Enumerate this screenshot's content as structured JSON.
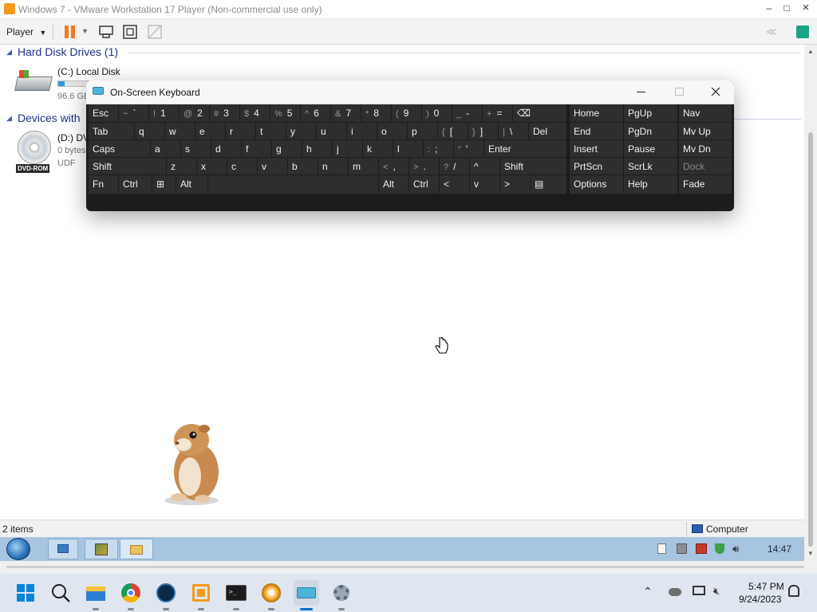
{
  "vm": {
    "title": "Windows 7 - VMware Workstation 17 Player (Non-commercial use only)",
    "menu_label": "Player",
    "window_controls": {
      "minimize": "–",
      "maximize": "□",
      "close": "×"
    },
    "collapse_label": "≪"
  },
  "explorer": {
    "group_hdd": "Hard Disk Drives (1)",
    "group_devices": "Devices with",
    "drive_c": {
      "name": "(C:) Local Disk",
      "size": "96.6 GB",
      "fill_fraction": 0.22
    },
    "drive_d": {
      "name": "(D:) DV",
      "size": "0 bytes",
      "fs": "UDF",
      "badge": "DVD-ROM"
    },
    "status_count": "2 items",
    "status_location": "Computer"
  },
  "osk": {
    "title": "On-Screen Keyboard",
    "rows": [
      [
        {
          "label": "Esc"
        },
        {
          "shift": "~",
          "label": "`"
        },
        {
          "shift": "!",
          "label": "1"
        },
        {
          "shift": "@",
          "label": "2"
        },
        {
          "shift": "#",
          "label": "3"
        },
        {
          "shift": "$",
          "label": "4"
        },
        {
          "shift": "%",
          "label": "5"
        },
        {
          "shift": "^",
          "label": "6"
        },
        {
          "shift": "&",
          "label": "7"
        },
        {
          "shift": "*",
          "label": "8"
        },
        {
          "shift": "(",
          "label": "9"
        },
        {
          "shift": ")",
          "label": "0"
        },
        {
          "shift": "_",
          "label": "-"
        },
        {
          "shift": "+",
          "label": "="
        },
        {
          "label": "⌫"
        }
      ],
      [
        {
          "label": "Tab"
        },
        {
          "label": "q"
        },
        {
          "label": "w"
        },
        {
          "label": "e"
        },
        {
          "label": "r"
        },
        {
          "label": "t"
        },
        {
          "label": "y"
        },
        {
          "label": "u"
        },
        {
          "label": "i"
        },
        {
          "label": "o"
        },
        {
          "label": "p"
        },
        {
          "shift": "{",
          "label": "["
        },
        {
          "shift": "}",
          "label": "]"
        },
        {
          "shift": "|",
          "label": "\\"
        },
        {
          "label": "Del"
        }
      ],
      [
        {
          "label": "Caps"
        },
        {
          "label": "a"
        },
        {
          "label": "s"
        },
        {
          "label": "d"
        },
        {
          "label": "f"
        },
        {
          "label": "g"
        },
        {
          "label": "h"
        },
        {
          "label": "j"
        },
        {
          "label": "k"
        },
        {
          "label": "l"
        },
        {
          "shift": ":",
          "label": ";"
        },
        {
          "shift": "\"",
          "label": "'"
        },
        {
          "label": "Enter"
        }
      ],
      [
        {
          "label": "Shift"
        },
        {
          "label": "z"
        },
        {
          "label": "x"
        },
        {
          "label": "c"
        },
        {
          "label": "v"
        },
        {
          "label": "b"
        },
        {
          "label": "n"
        },
        {
          "label": "m"
        },
        {
          "shift": "<",
          "label": ","
        },
        {
          "shift": ">",
          "label": "."
        },
        {
          "shift": "?",
          "label": "/"
        },
        {
          "label": "^"
        },
        {
          "label": "Shift"
        }
      ],
      [
        {
          "label": "Fn"
        },
        {
          "label": "Ctrl"
        },
        {
          "label": "⊞"
        },
        {
          "label": "Alt"
        },
        {
          "label": ""
        },
        {
          "label": "Alt"
        },
        {
          "label": "Ctrl"
        },
        {
          "label": "<"
        },
        {
          "label": "v"
        },
        {
          "label": ">"
        },
        {
          "label": "▤"
        }
      ]
    ],
    "nav": [
      [
        "Home",
        "PgUp",
        "Nav"
      ],
      [
        "End",
        "PgDn",
        "Mv Up"
      ],
      [
        "Insert",
        "Pause",
        "Mv Dn"
      ],
      [
        "PrtScn",
        "ScrLk",
        "Dock"
      ],
      [
        "Options",
        "Help",
        "Fade"
      ]
    ]
  },
  "guest_taskbar": {
    "clock": "14:47"
  },
  "host_taskbar": {
    "time": "5:47 PM",
    "date": "9/24/2023",
    "apps": [
      "start-icon",
      "search-icon",
      "file-explorer-icon",
      "chrome-icon",
      "photos-icon",
      "vmware-icon",
      "terminal-icon",
      "media-player-icon",
      "keyboard-icon",
      "settings-icon"
    ]
  }
}
